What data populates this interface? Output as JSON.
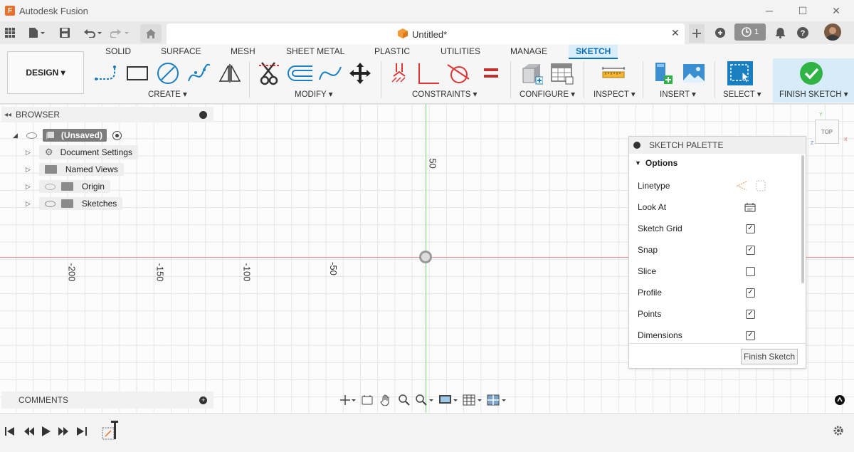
{
  "app": {
    "title": "Autodesk Fusion"
  },
  "document": {
    "title": "Untitled*"
  },
  "notifications": {
    "jobs_count": "1"
  },
  "workspace_tabs": [
    "SOLID",
    "SURFACE",
    "MESH",
    "SHEET METAL",
    "PLASTIC",
    "UTILITIES",
    "MANAGE",
    "SKETCH"
  ],
  "active_tab": "SKETCH",
  "design_button": "DESIGN ▾",
  "groups": {
    "create": "CREATE ▾",
    "modify": "MODIFY ▾",
    "constraints": "CONSTRAINTS ▾",
    "configure": "CONFIGURE ▾",
    "inspect": "INSPECT ▾",
    "insert": "INSERT ▾",
    "select": "SELECT ▾",
    "finish_sketch": "FINISH SKETCH ▾"
  },
  "browser": {
    "title": "BROWSER",
    "root": "(Unsaved)",
    "items": [
      "Document Settings",
      "Named Views",
      "Origin",
      "Sketches"
    ]
  },
  "comments": {
    "title": "COMMENTS"
  },
  "canvas": {
    "tick_labels_x": [
      "-200",
      "-150",
      "-100",
      "-50"
    ],
    "tick_label_y": "50"
  },
  "viewcube": {
    "face": "TOP",
    "x_label": "X",
    "y_label": "Y",
    "z_label": "Z"
  },
  "palette": {
    "title": "SKETCH PALETTE",
    "section": "Options",
    "rows": [
      {
        "label": "Linetype",
        "control": "icons"
      },
      {
        "label": "Look At",
        "control": "icon"
      },
      {
        "label": "Sketch Grid",
        "checked": true
      },
      {
        "label": "Snap",
        "checked": true
      },
      {
        "label": "Slice",
        "checked": false
      },
      {
        "label": "Profile",
        "checked": true
      },
      {
        "label": "Points",
        "checked": true
      },
      {
        "label": "Dimensions",
        "checked": true
      }
    ],
    "finish_button": "Finish Sketch"
  },
  "colors": {
    "accent": "#0b6eb6",
    "finish_green": "#2fb344",
    "x_axis": "#e48c8c",
    "y_axis": "#78d578"
  }
}
